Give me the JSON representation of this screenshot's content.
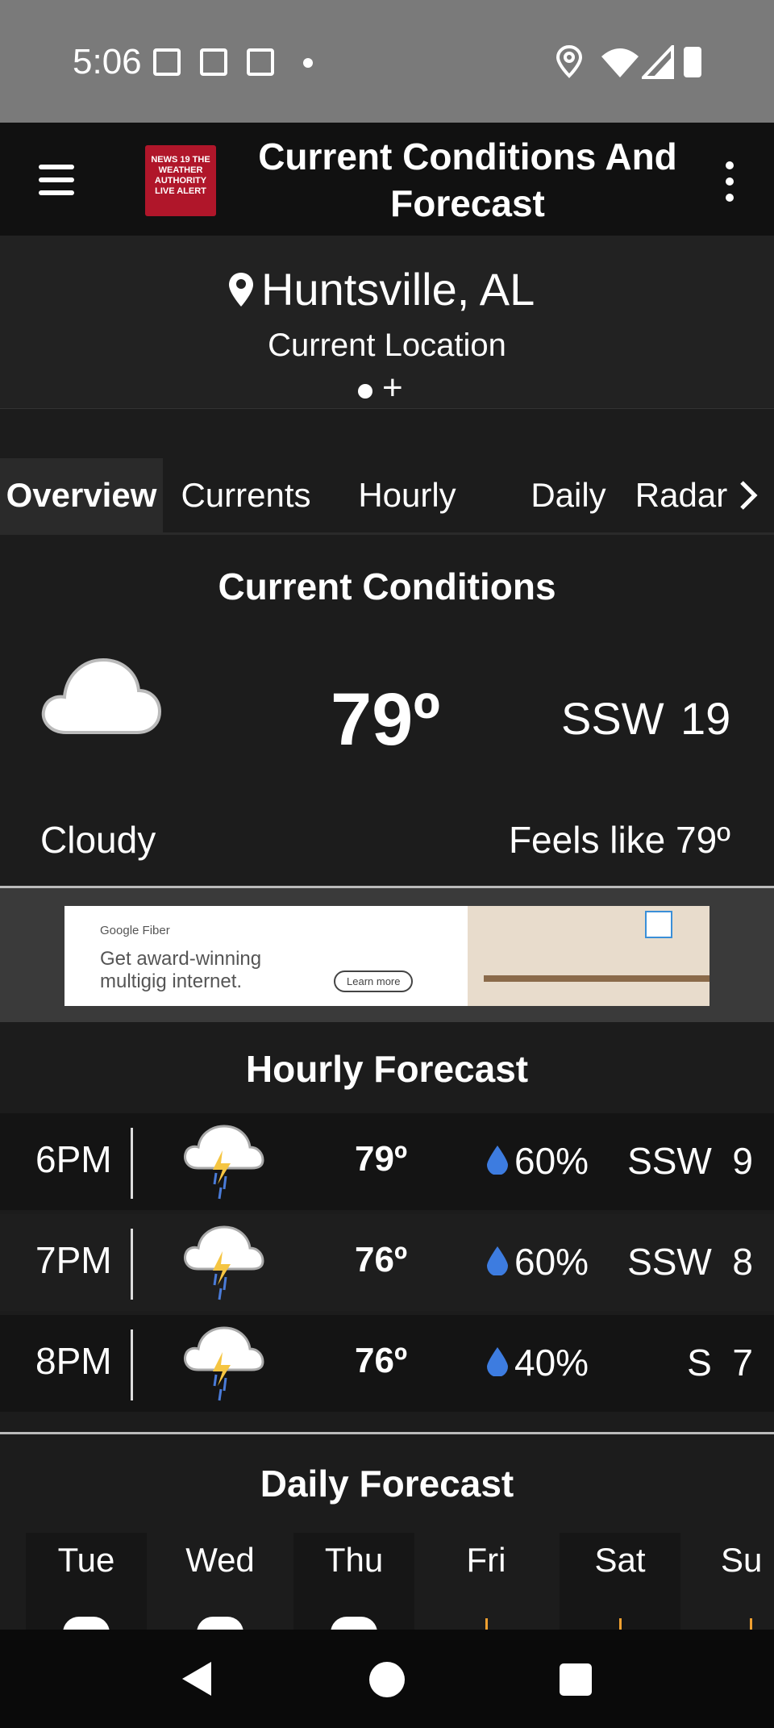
{
  "status_bar": {
    "time": "5:06"
  },
  "app_bar": {
    "logo_text": "NEWS 19 THE WEATHER AUTHORITY LIVE ALERT",
    "title": "Current Conditions And Forecast"
  },
  "location": {
    "city": "Huntsville, AL",
    "subtitle": "Current Location",
    "add_symbol": "+"
  },
  "tabs": [
    {
      "label": "Overview",
      "active": true
    },
    {
      "label": "Currents"
    },
    {
      "label": "Hourly"
    },
    {
      "label": "Daily"
    },
    {
      "label": "Radar"
    }
  ],
  "current": {
    "heading": "Current Conditions",
    "icon": "cloud-icon",
    "temp": "79º",
    "wind_dir": "SSW",
    "wind_speed": "19",
    "condition": "Cloudy",
    "feels_like": "Feels like 79º"
  },
  "ad": {
    "brand": "Google Fiber",
    "headline_1": "Get award-winning",
    "headline_2": "multigig internet.",
    "cta": "Learn more"
  },
  "hourly": {
    "heading": "Hourly Forecast",
    "rows": [
      {
        "time": "6PM",
        "icon": "thunderstorm-icon",
        "temp": "79º",
        "precip": "60%",
        "wind_dir": "SSW",
        "wind_speed": "9"
      },
      {
        "time": "7PM",
        "icon": "thunderstorm-icon",
        "temp": "76º",
        "precip": "60%",
        "wind_dir": "SSW",
        "wind_speed": "8"
      },
      {
        "time": "8PM",
        "icon": "thunderstorm-icon",
        "temp": "76º",
        "precip": "40%",
        "wind_dir": "S",
        "wind_speed": "7"
      }
    ]
  },
  "daily": {
    "heading": "Daily Forecast",
    "days": [
      "Tue",
      "Wed",
      "Thu",
      "Fri",
      "Sat",
      "Su"
    ]
  },
  "colors": {
    "accent": "#4a7bd8",
    "background": "#1c1c1c",
    "logo_red": "#b0162a"
  }
}
